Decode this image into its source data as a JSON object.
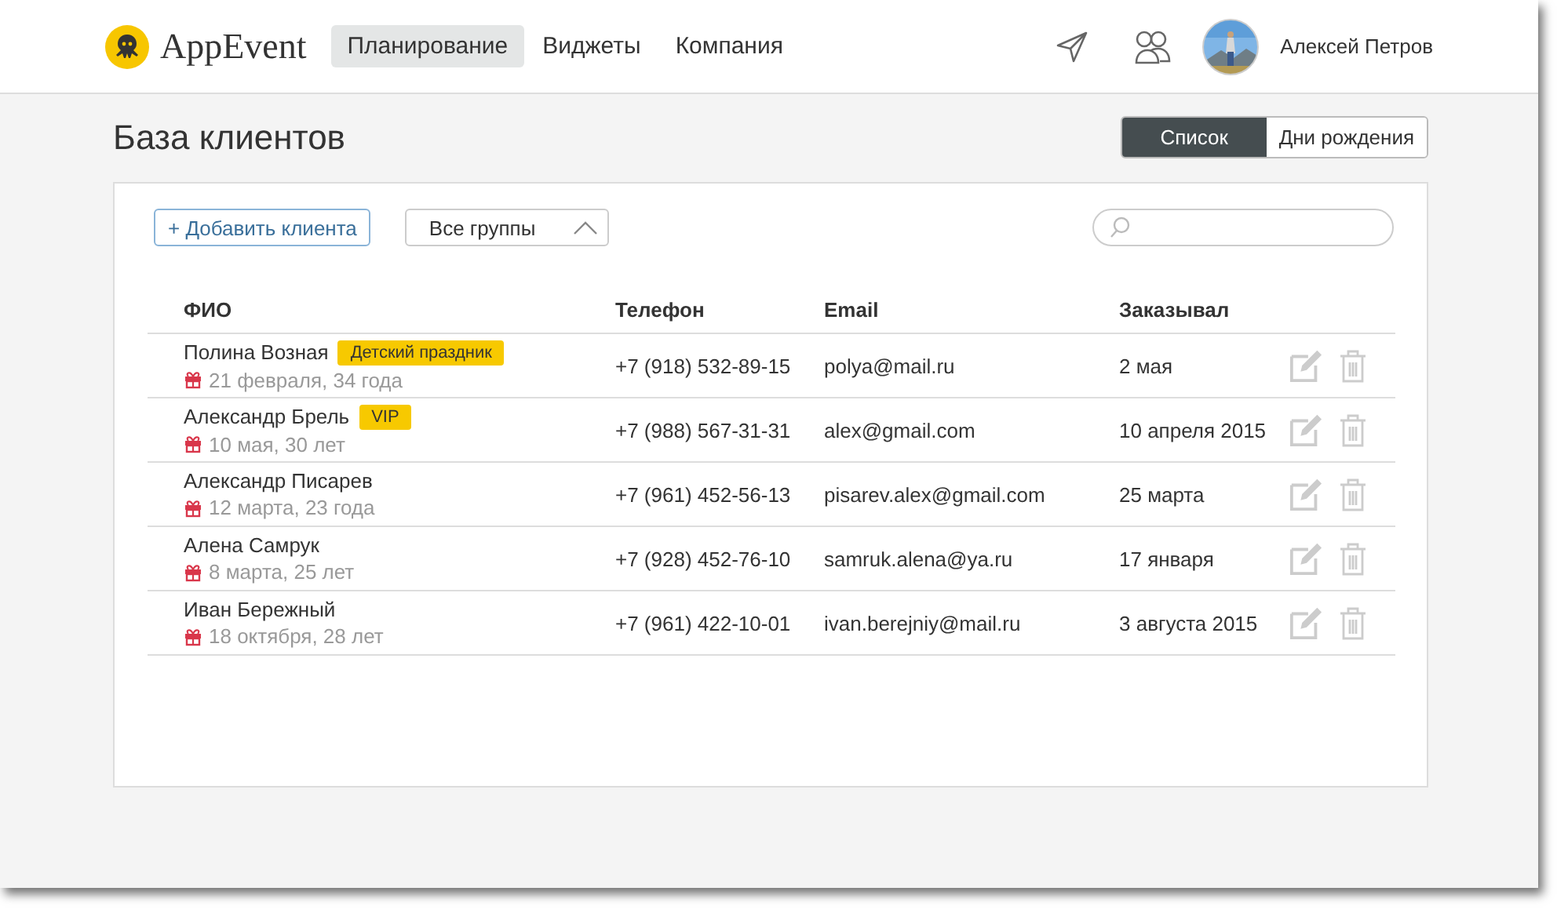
{
  "header": {
    "logo": "AppEvent",
    "nav": [
      {
        "label": "Планирование",
        "selected": true
      },
      {
        "label": "Виджеты",
        "selected": false
      },
      {
        "label": "Компания",
        "selected": false
      }
    ],
    "user": {
      "name": "Алексей Петров"
    }
  },
  "page": {
    "title": "База клиентов",
    "views": [
      {
        "label": "Список",
        "selected": true
      },
      {
        "label": "Дни рождения",
        "selected": false
      }
    ]
  },
  "toolbar": {
    "add_button": "+ Добавить клиента",
    "group_filter": {
      "value": "Все группы",
      "expanded": true
    }
  },
  "table": {
    "columns": [
      "ФИО",
      "Телефон",
      "Email",
      "Заказывал"
    ],
    "rows": [
      {
        "name": "Полина Возная",
        "tag": "Детский праздник",
        "birthday": "21 февраля, 34 года",
        "phone": "+7 (918) 532-89-15",
        "email": "polya@mail.ru",
        "ordered": "2 мая"
      },
      {
        "name": "Александр Брель",
        "tag": "VIP",
        "birthday": "10 мая, 30 лет",
        "phone": "+7 (988) 567-31-31",
        "email": "alex@gmail.com",
        "ordered": "10 апреля 2015"
      },
      {
        "name": "Александр Писарев",
        "birthday": "12 марта, 23 года",
        "phone": "+7 (961) 452-56-13",
        "email": "pisarev.alex@gmail.com",
        "ordered": "25 марта"
      },
      {
        "name": "Алена Самрук",
        "birthday": "8 марта, 25 лет",
        "phone": "+7 (928) 452-76-10",
        "email": "samruk.alena@ya.ru",
        "ordered": "17 января"
      },
      {
        "name": "Иван Бережный",
        "birthday": "18 октября, 28 лет",
        "phone": "+7 (961) 422-10-01",
        "email": "ivan.berejniy@mail.ru",
        "ordered": "3 августа 2015"
      }
    ]
  }
}
